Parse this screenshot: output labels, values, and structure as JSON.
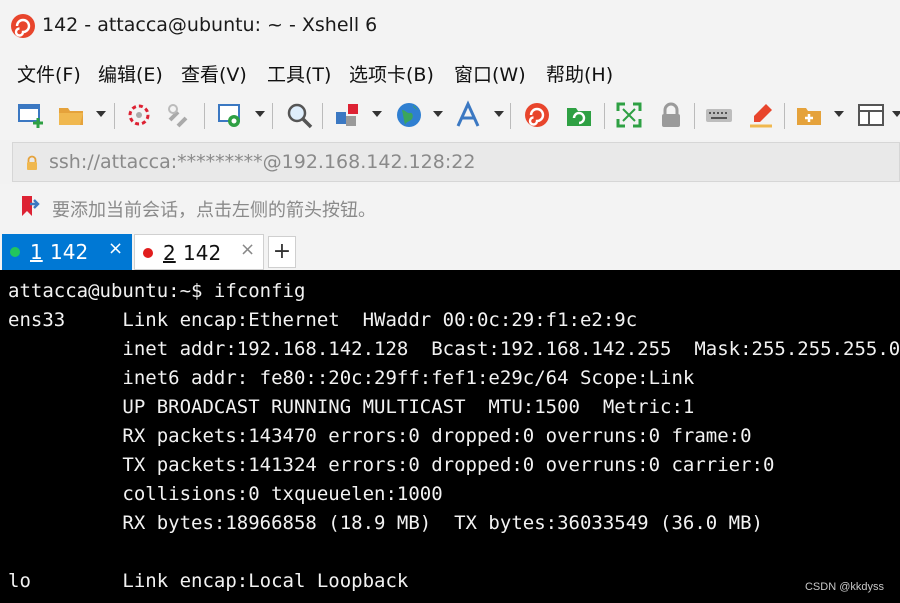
{
  "window": {
    "title": "142 - attacca@ubuntu: ~ - Xshell 6"
  },
  "menu": [
    "文件(F)",
    "编辑(E)",
    "查看(V)",
    "工具(T)",
    "选项卡(B)",
    "窗口(W)",
    "帮助(H)"
  ],
  "address": {
    "value": "ssh://attacca:*********@192.168.142.128:22"
  },
  "hint": {
    "text": "要添加当前会话，点击左侧的箭头按钮。"
  },
  "tabs": [
    {
      "num": "1",
      "name": "142",
      "close": "×",
      "status_color": "#22c55e",
      "active": true
    },
    {
      "num": "2",
      "name": "142",
      "close": "×",
      "status_color": "#e11d1d",
      "active": false
    }
  ],
  "tab_add": "+",
  "terminal": {
    "lines": [
      "attacca@ubuntu:~$ ifconfig",
      "ens33     Link encap:Ethernet  HWaddr 00:0c:29:f1:e2:9c",
      "          inet addr:192.168.142.128  Bcast:192.168.142.255  Mask:255.255.255.0",
      "          inet6 addr: fe80::20c:29ff:fef1:e29c/64 Scope:Link",
      "          UP BROADCAST RUNNING MULTICAST  MTU:1500  Metric:1",
      "          RX packets:143470 errors:0 dropped:0 overruns:0 frame:0",
      "          TX packets:141324 errors:0 dropped:0 overruns:0 carrier:0",
      "          collisions:0 txqueuelen:1000",
      "          RX bytes:18966858 (18.9 MB)  TX bytes:36033549 (36.0 MB)",
      "",
      "lo        Link encap:Local Loopback"
    ]
  },
  "watermark": "CSDN @kkdyss",
  "colors": {
    "active_tab": "#0078d4",
    "terminal_bg": "#000000",
    "terminal_fg": "#f2f2f2"
  }
}
